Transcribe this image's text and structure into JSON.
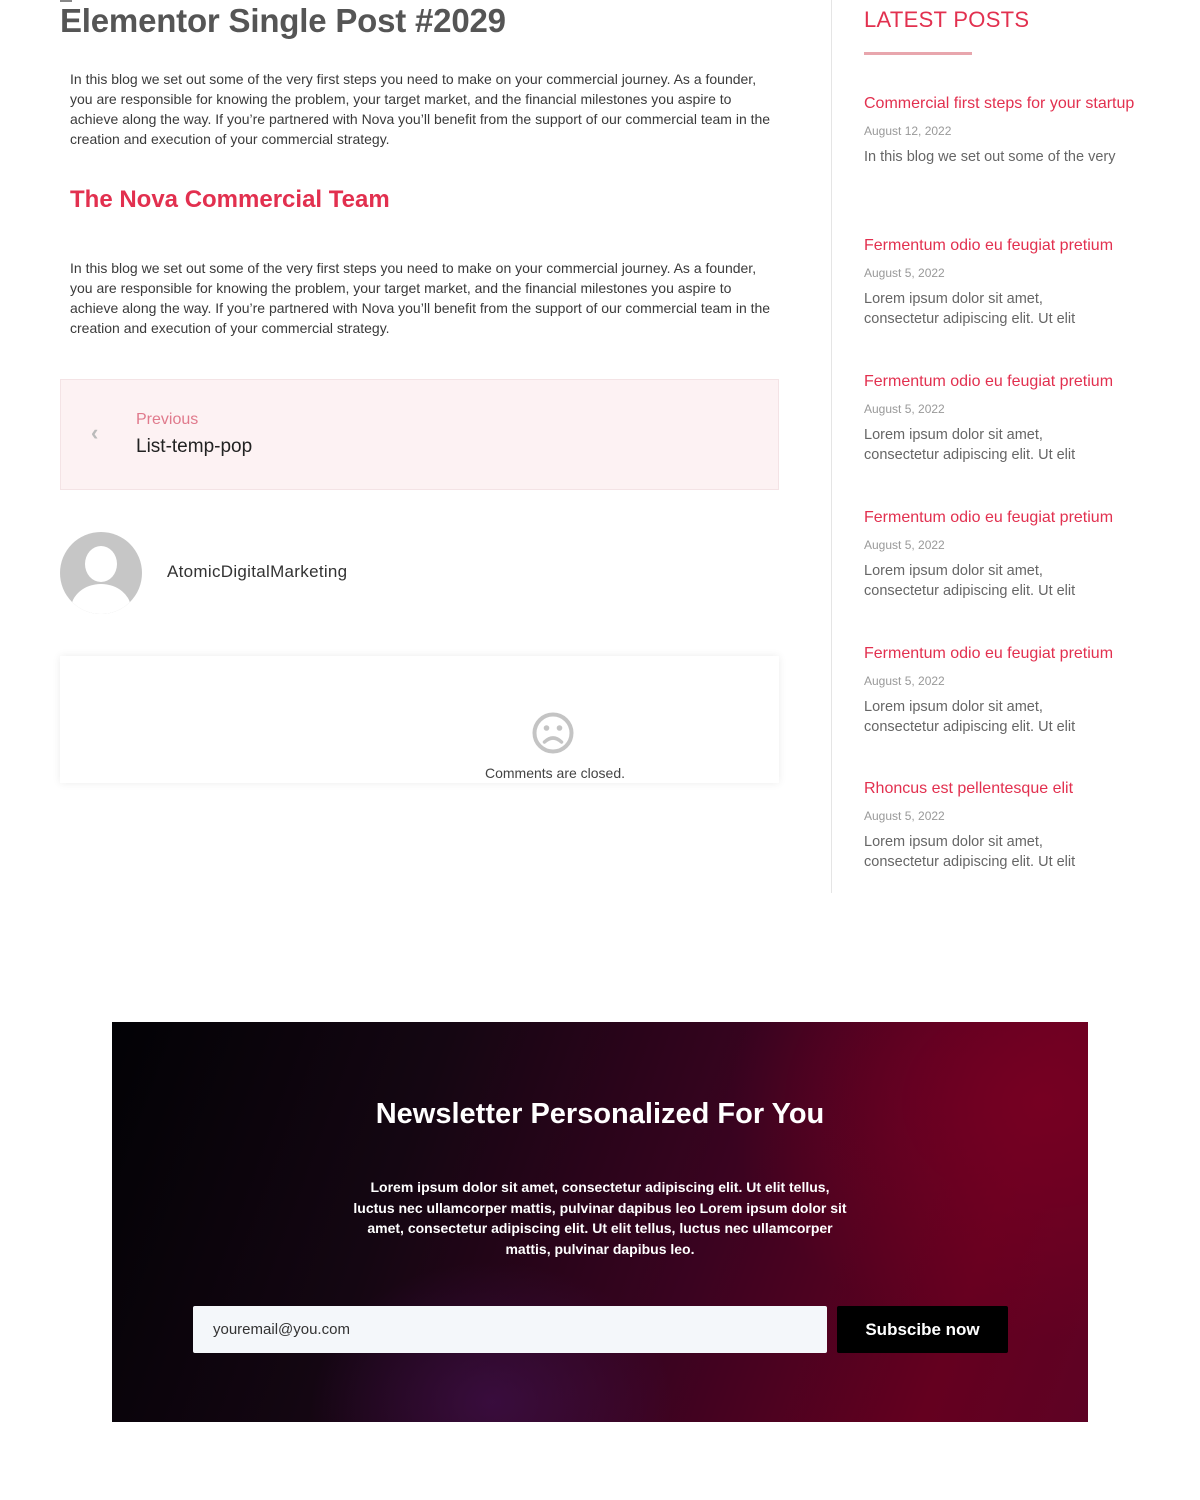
{
  "post": {
    "title": "Elementor Single Post #2029",
    "paragraph_1": "In this blog we set out some of the very first steps you need to make on your commercial journey. As a founder, you are responsible for knowing the problem, your target market, and the financial milestones you aspire to achieve along the way. If you’re partnered with Nova you’ll benefit from the support of our commercial team in the creation and execution of your commercial strategy.",
    "section_heading": "The Nova Commercial Team",
    "paragraph_2": "In this blog we set out some of the very first steps you need to make on your commercial journey. As a founder, you are responsible for knowing the problem, your target market, and the financial milestones you aspire to achieve along the way. If you’re partnered with Nova you’ll benefit from the support of our commercial team in the creation and execution of your commercial strategy."
  },
  "post_nav": {
    "chevron": "‹",
    "label": "Previous",
    "title": "List-temp-pop"
  },
  "author": {
    "name": "AtomicDigitalMarketing"
  },
  "comments": {
    "icon": "sad-face-icon",
    "text": "Comments are closed."
  },
  "sidebar": {
    "heading": "LATEST POSTS",
    "posts": [
      {
        "title": "Commercial first steps for your startup",
        "date": "August 12, 2022",
        "excerpt": "In this blog we set out some of the very"
      },
      {
        "title": "Fermentum odio eu feugiat pretium",
        "date": "August 5, 2022",
        "excerpt": "Lorem ipsum dolor sit amet, consectetur adipiscing elit. Ut elit"
      },
      {
        "title": "Fermentum odio eu feugiat pretium",
        "date": "August 5, 2022",
        "excerpt": "Lorem ipsum dolor sit amet, consectetur adipiscing elit. Ut elit"
      },
      {
        "title": "Fermentum odio eu feugiat pretium",
        "date": "August 5, 2022",
        "excerpt": "Lorem ipsum dolor sit amet, consectetur adipiscing elit. Ut elit"
      },
      {
        "title": "Fermentum odio eu feugiat pretium",
        "date": "August 5, 2022",
        "excerpt": "Lorem ipsum dolor sit amet, consectetur adipiscing elit. Ut elit"
      },
      {
        "title": "Rhoncus est pellentesque elit",
        "date": "August 5, 2022",
        "excerpt": "Lorem ipsum dolor sit amet, consectetur adipiscing elit. Ut elit"
      }
    ]
  },
  "newsletter": {
    "title": "Newsletter Personalized For You",
    "text": "Lorem ipsum dolor sit amet, consectetur adipiscing elit. Ut elit tellus, luctus nec ullamcorper mattis, pulvinar dapibus leo Lorem ipsum dolor sit amet, consectetur adipiscing elit. Ut elit tellus, luctus nec ullamcorper mattis, pulvinar dapibus leo.",
    "email_value": "youremail@you.com",
    "button_label": "Subscibe now"
  },
  "colors": {
    "accent": "#e2304f",
    "nav_background": "#fdf2f3",
    "button_background": "#000000"
  }
}
